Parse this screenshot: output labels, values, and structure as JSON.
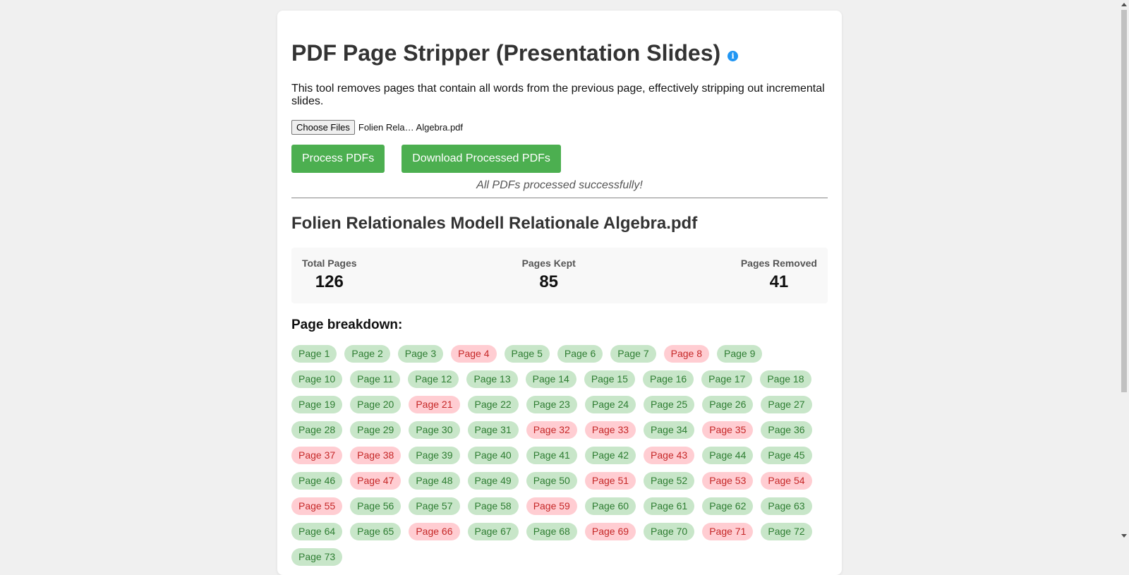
{
  "header": {
    "title": "PDF Page Stripper (Presentation Slides)",
    "info_icon": "i"
  },
  "description": "This tool removes pages that contain all words from the previous page, effectively stripping out incremental slides.",
  "file_input": {
    "button_label": "Choose Files",
    "selected_file": "Folien Rela… Algebra.pdf"
  },
  "buttons": {
    "process": "Process PDFs",
    "download": "Download Processed PDFs"
  },
  "status": "All PDFs processed successfully!",
  "result": {
    "filename": "Folien Relationales Modell Relationale Algebra.pdf",
    "stats": {
      "total_label": "Total Pages",
      "total_value": "126",
      "kept_label": "Pages Kept",
      "kept_value": "85",
      "removed_label": "Pages Removed",
      "removed_value": "41"
    },
    "breakdown_title": "Page breakdown:",
    "removed_pages": [
      4,
      8,
      21,
      32,
      33,
      35,
      37,
      38,
      43,
      47,
      51,
      53,
      54,
      55,
      59,
      66,
      69,
      71
    ],
    "visible_page_count": 73,
    "page_label_prefix": "Page"
  },
  "colors": {
    "accent_green": "#4CAF50",
    "kept_bg": "#c8e6c9",
    "kept_text": "#2e7d32",
    "removed_bg": "#ffcdd2",
    "removed_text": "#c62828",
    "info_blue": "#2196F3"
  }
}
